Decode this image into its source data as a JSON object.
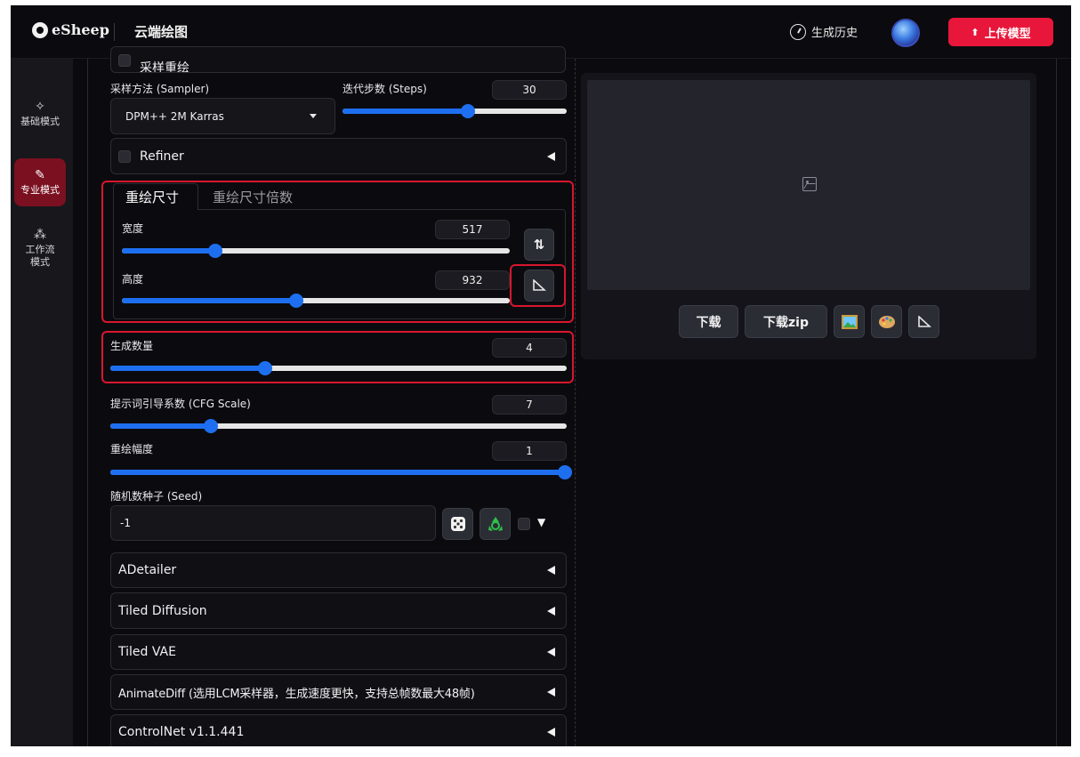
{
  "header": {
    "logo_text": "eSheep",
    "app_title": "云端绘图",
    "history_label": "生成历史",
    "upload_label": "上传模型",
    "upload_color": "#e8163a"
  },
  "sidebar": {
    "items": [
      {
        "label": "基础模式",
        "icon": "sparkle-icon"
      },
      {
        "label": "专业模式",
        "icon": "brush-icon",
        "active": true
      },
      {
        "label": "工作流模式",
        "icon": "workflow-icon"
      }
    ]
  },
  "top_cut_label": "采样重绘",
  "sampler": {
    "label": "采样方法 (Sampler)",
    "value": "DPM++ 2M Karras"
  },
  "steps": {
    "label": "迭代步数 (Steps)",
    "value": "30",
    "fraction": 0.56
  },
  "refiner": {
    "label": "Refiner"
  },
  "resize": {
    "tabs": [
      "重绘尺寸",
      "重绘尺寸倍数"
    ],
    "width": {
      "label": "宽度",
      "value": "517",
      "fraction": 0.24
    },
    "height": {
      "label": "高度",
      "value": "932",
      "fraction": 0.45
    },
    "swap_icon": "⇅"
  },
  "batch": {
    "label": "生成数量",
    "value": "4",
    "fraction": 0.34
  },
  "cfg": {
    "label": "提示词引导系数 (CFG Scale)",
    "value": "7",
    "fraction": 0.22
  },
  "denoise": {
    "label": "重绘幅度",
    "value": "1",
    "fraction": 1.0
  },
  "seed": {
    "label": "随机数种子 (Seed)",
    "value": "-1",
    "more_icon": "▼"
  },
  "accordions": [
    "ADetailer",
    "Tiled Diffusion",
    "Tiled VAE",
    "AnimateDiff (选用LCM采样器，生成速度更快，支持总帧数最大48帧)",
    "ControlNet v1.1.441"
  ],
  "output": {
    "download_label": "下载",
    "download_zip_label": "下载zip"
  },
  "colors": {
    "accent": "#1e6ff0",
    "highlight": "#d9162e"
  }
}
